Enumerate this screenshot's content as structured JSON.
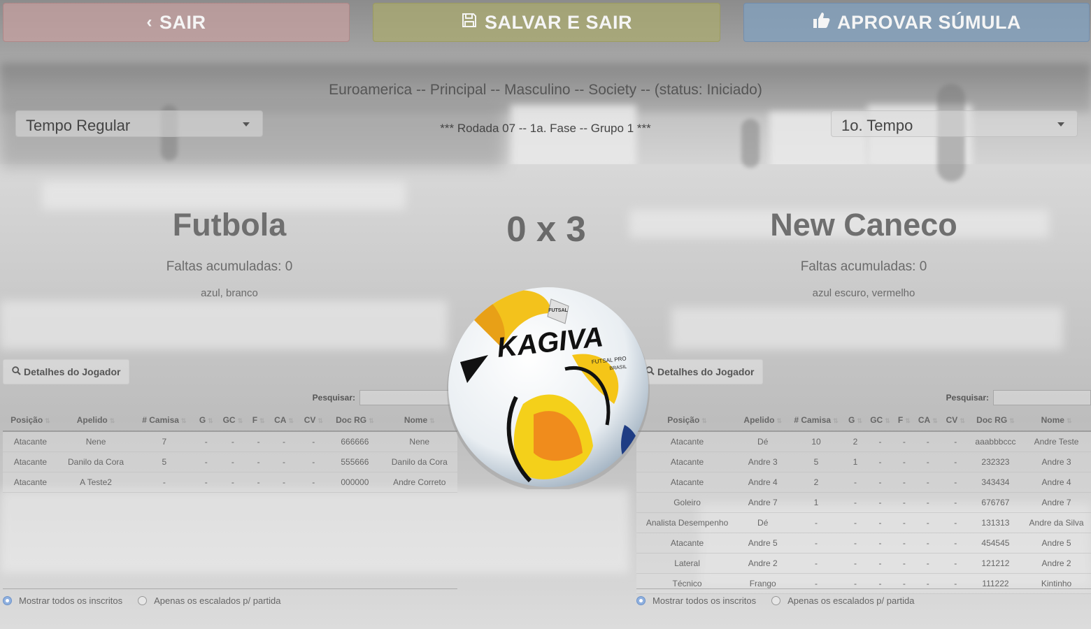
{
  "toolbar": {
    "exit_label": "SAIR",
    "save_exit_label": "SALVAR E SAIR",
    "approve_label": "APROVAR SÚMULA"
  },
  "match": {
    "title": "Euroamerica -- Principal -- Masculino -- Society -- (status: Iniciado)",
    "round": "*** Rodada 07 -- 1a. Fase -- Grupo 1 ***",
    "score": "0 x 3",
    "period_select": "Tempo Regular",
    "half_select": "1o. Tempo"
  },
  "ball": {
    "brand": "KAGIVA",
    "tagline": "FUTSAL PRO",
    "tag": "FUTSAL",
    "country": "BRASIL"
  },
  "home": {
    "name": "Futbola",
    "fouls": "Faltas acumuladas: 0",
    "colors": "azul, branco",
    "details_label": "Detalhes do Jogador",
    "search_label": "Pesquisar:",
    "columns": [
      "Posição",
      "Apelido",
      "# Camisa",
      "G",
      "GC",
      "F",
      "CA",
      "CV",
      "Doc RG",
      "Nome"
    ],
    "rows": [
      [
        "Atacante",
        "Nene",
        "7",
        "-",
        "-",
        "-",
        "-",
        "-",
        "666666",
        "Nene"
      ],
      [
        "Atacante",
        "Danilo da Cora",
        "5",
        "-",
        "-",
        "-",
        "-",
        "-",
        "555666",
        "Danilo da Cora"
      ],
      [
        "Atacante",
        "A Teste2",
        "-",
        "-",
        "-",
        "-",
        "-",
        "-",
        "000000",
        "Andre Correto"
      ]
    ],
    "radio_all": "Mostrar todos os inscritos",
    "radio_lineup": "Apenas os escalados p/ partida"
  },
  "away": {
    "name": "New Caneco",
    "fouls": "Faltas acumuladas: 0",
    "colors": "azul escuro, vermelho",
    "details_label": "Detalhes do Jogador",
    "search_label": "Pesquisar:",
    "columns": [
      "Posição",
      "Apelido",
      "# Camisa",
      "G",
      "GC",
      "F",
      "CA",
      "CV",
      "Doc RG",
      "Nome"
    ],
    "rows": [
      [
        "Atacante",
        "Dé",
        "10",
        "2",
        "-",
        "-",
        "-",
        "-",
        "aaabbbccc",
        "Andre Teste"
      ],
      [
        "Atacante",
        "Andre 3",
        "5",
        "1",
        "-",
        "-",
        "-",
        "-",
        "232323",
        "Andre 3"
      ],
      [
        "Atacante",
        "Andre 4",
        "2",
        "-",
        "-",
        "-",
        "-",
        "-",
        "343434",
        "Andre 4"
      ],
      [
        "Goleiro",
        "Andre 7",
        "1",
        "-",
        "-",
        "-",
        "-",
        "-",
        "676767",
        "Andre 7"
      ],
      [
        "Analista Desempenho",
        "Dé",
        "-",
        "-",
        "-",
        "-",
        "-",
        "-",
        "131313",
        "Andre da Silva"
      ],
      [
        "Atacante",
        "Andre 5",
        "-",
        "-",
        "-",
        "-",
        "-",
        "-",
        "454545",
        "Andre 5"
      ],
      [
        "Lateral",
        "Andre 2",
        "-",
        "-",
        "-",
        "-",
        "-",
        "-",
        "121212",
        "Andre 2"
      ],
      [
        "Técnico",
        "Frango",
        "-",
        "-",
        "-",
        "-",
        "-",
        "-",
        "111222",
        "Kintinho"
      ]
    ],
    "radio_all": "Mostrar todos os inscritos",
    "radio_lineup": "Apenas os escalados p/ partida"
  }
}
